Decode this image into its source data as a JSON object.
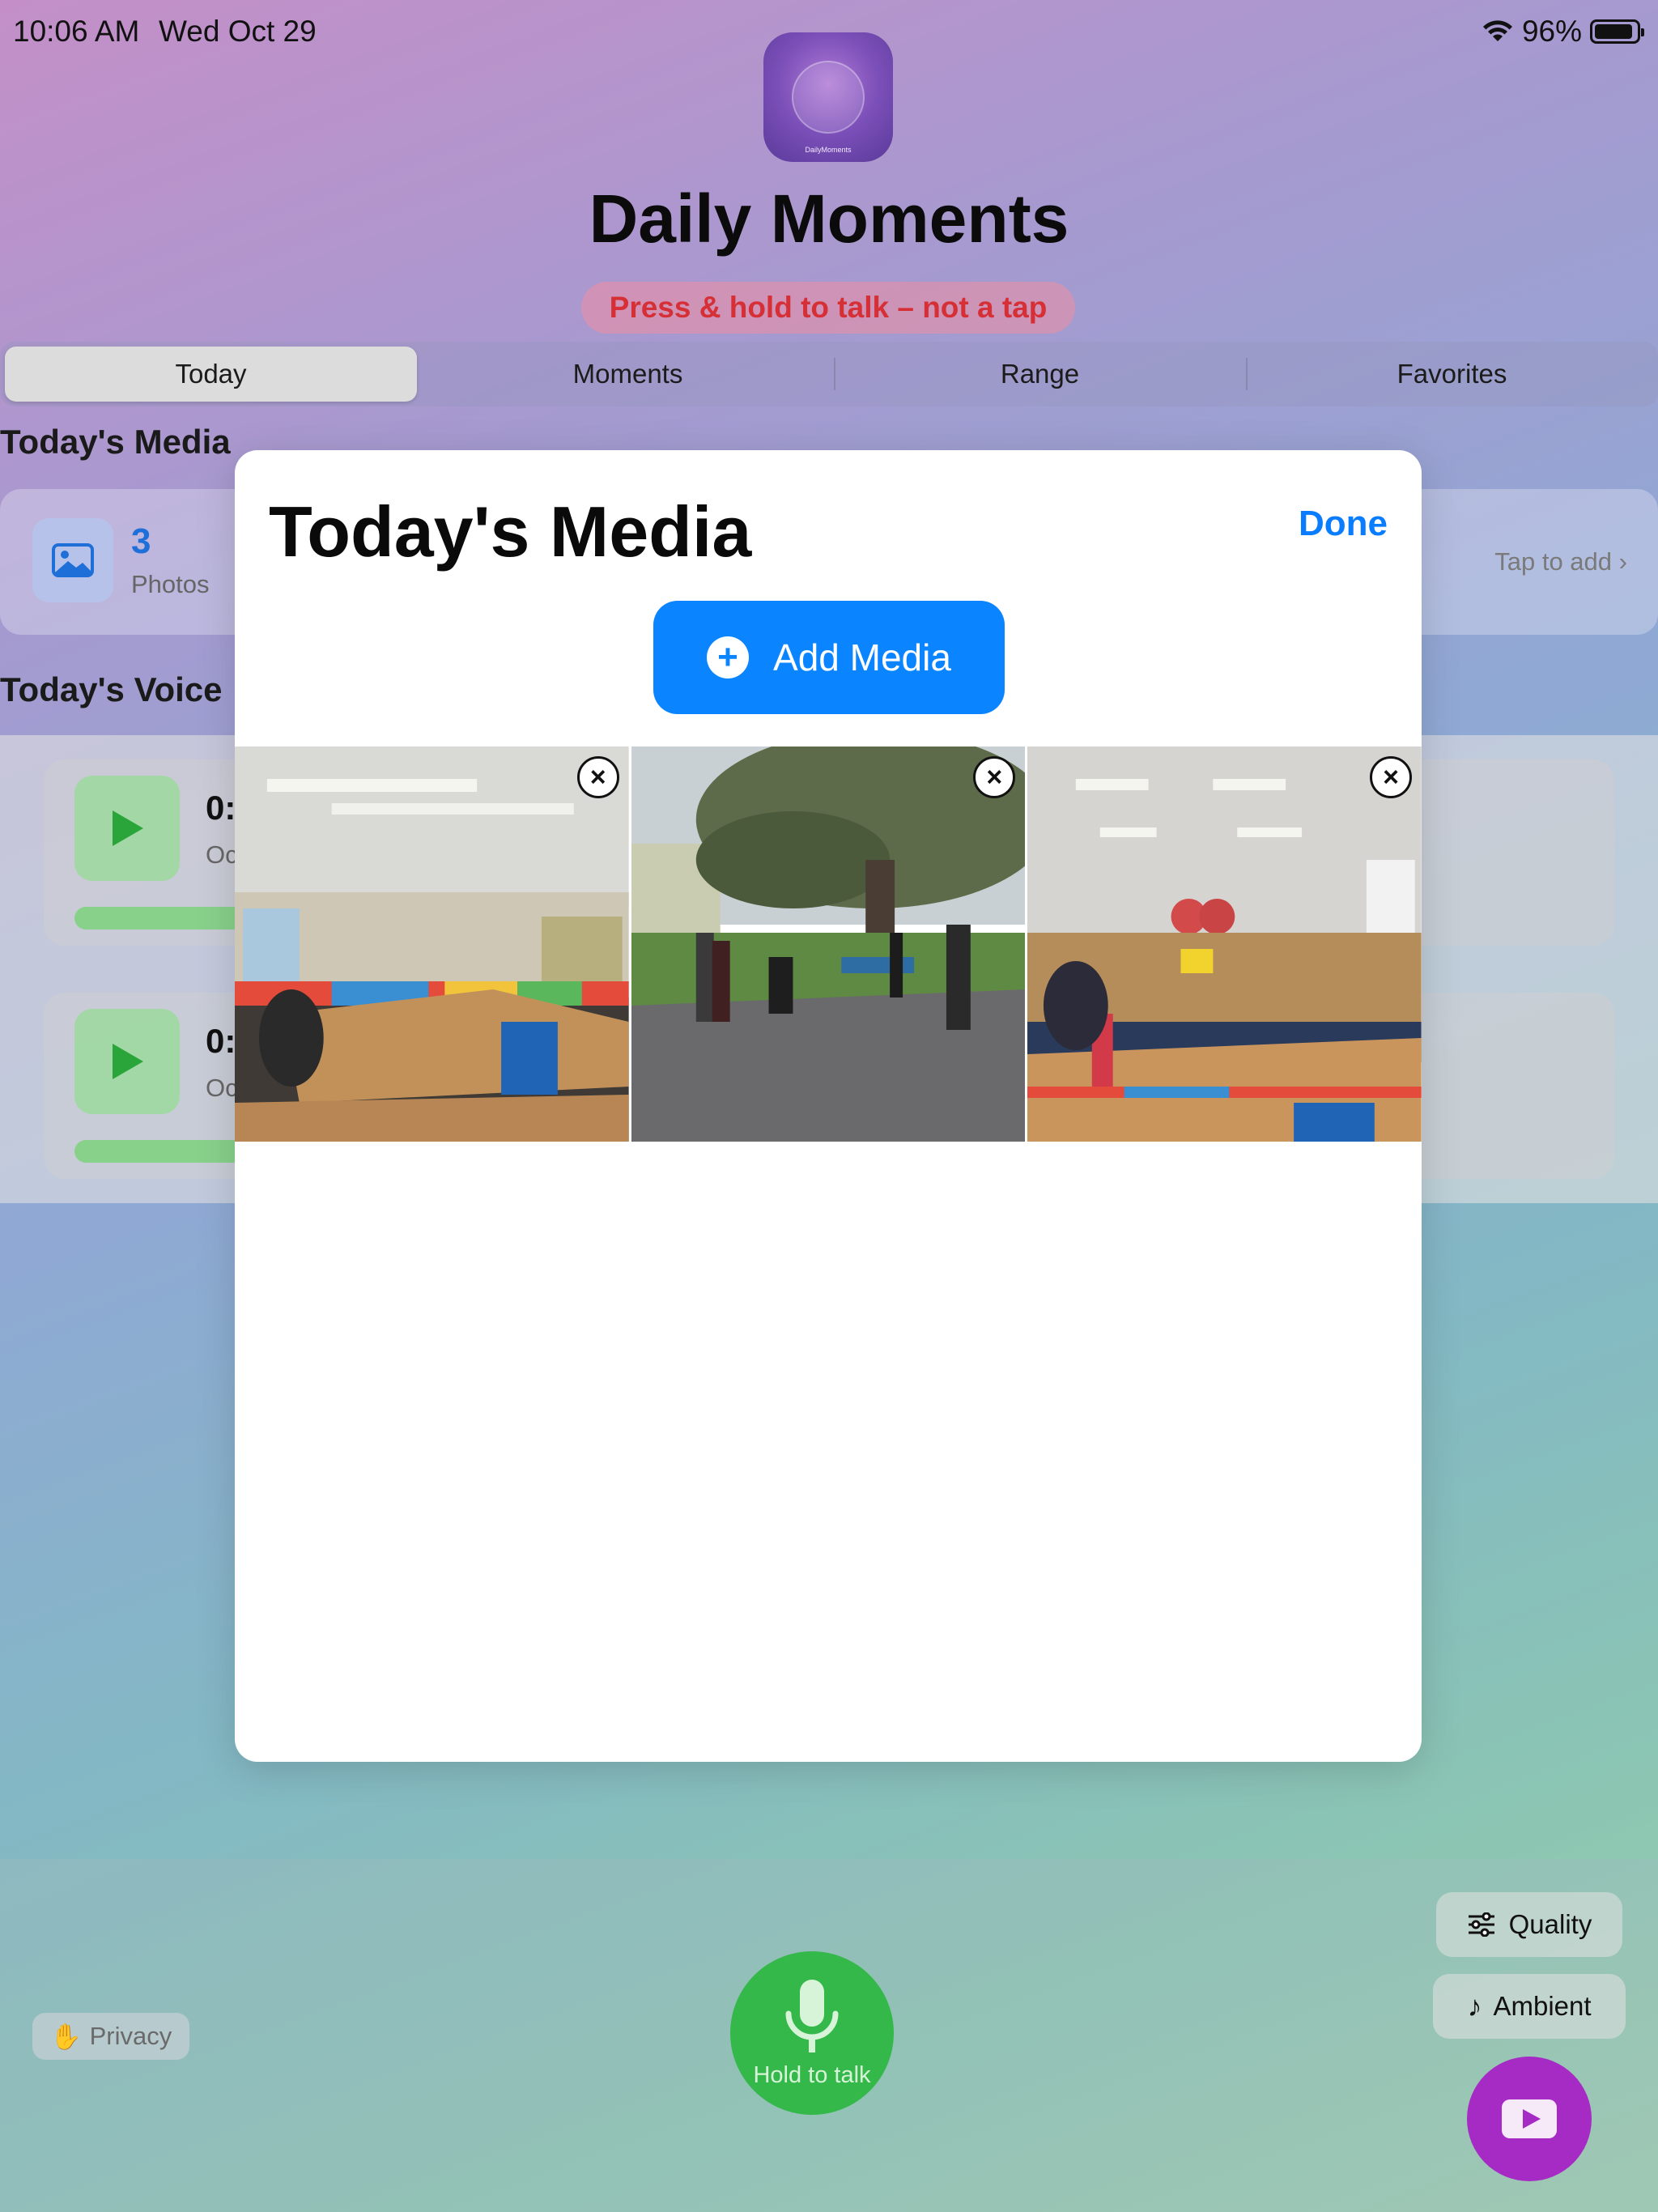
{
  "status_bar": {
    "time": "10:06 AM",
    "date": "Wed Oct 29",
    "battery": "96%"
  },
  "header": {
    "app_icon_text": "DailyMoments",
    "title": "Daily Moments",
    "hint": "Press & hold to talk – not a tap"
  },
  "tabs": [
    {
      "label": "Today",
      "active": true
    },
    {
      "label": "Moments",
      "active": false
    },
    {
      "label": "Range",
      "active": false
    },
    {
      "label": "Favorites",
      "active": false
    }
  ],
  "media_section": {
    "title": "Today's Media",
    "count": "3",
    "count_label": "Photos",
    "tap_to_add": "Tap to add"
  },
  "voice_section": {
    "title": "Today's Voice",
    "items": [
      {
        "time": "0:",
        "sub": "Oc"
      },
      {
        "time": "0:",
        "sub": "Oc"
      }
    ]
  },
  "bottom": {
    "privacy": "Privacy",
    "mic_label": "Hold to talk",
    "quality": "Quality",
    "ambient": "Ambient"
  },
  "modal": {
    "title": "Today's Media",
    "done": "Done",
    "add_media": "Add Media",
    "photos": [
      {
        "scene": "classroom"
      },
      {
        "scene": "outdoor-tree"
      },
      {
        "scene": "classroom"
      }
    ]
  },
  "colors": {
    "accent_blue": "#0a84ff",
    "green": "#34b84a",
    "purple": "#a52bc4",
    "hint_red": "#d62f35"
  }
}
